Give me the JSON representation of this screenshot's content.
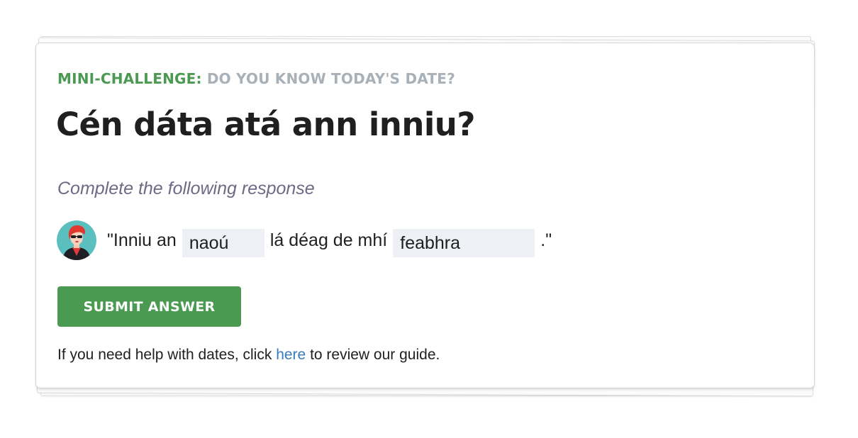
{
  "challenge": {
    "label": "MINI-CHALLENGE:",
    "question": "DO YOU KNOW TODAY'S DATE?",
    "title": "Cén dáta atá ann inniu?",
    "instruction": "Complete the following response"
  },
  "response": {
    "avatar_icon": "user-avatar-icon",
    "prefix": "\"Inniu an",
    "blank_one_value": "naoú",
    "middle": "lá déag de mhí",
    "blank_two_value": "feabhra",
    "suffix": ".\""
  },
  "submit": {
    "label": "SUBMIT ANSWER"
  },
  "help": {
    "before": "If you need help with dates, click",
    "link": "here",
    "after": "to review our guide."
  },
  "colors": {
    "accent_green": "#4a9a52",
    "muted_gray": "#a8b0b8",
    "instruction_purple": "#6c6a85",
    "link_blue": "#3a7bbf",
    "blank_bg": "#edf0f4"
  }
}
